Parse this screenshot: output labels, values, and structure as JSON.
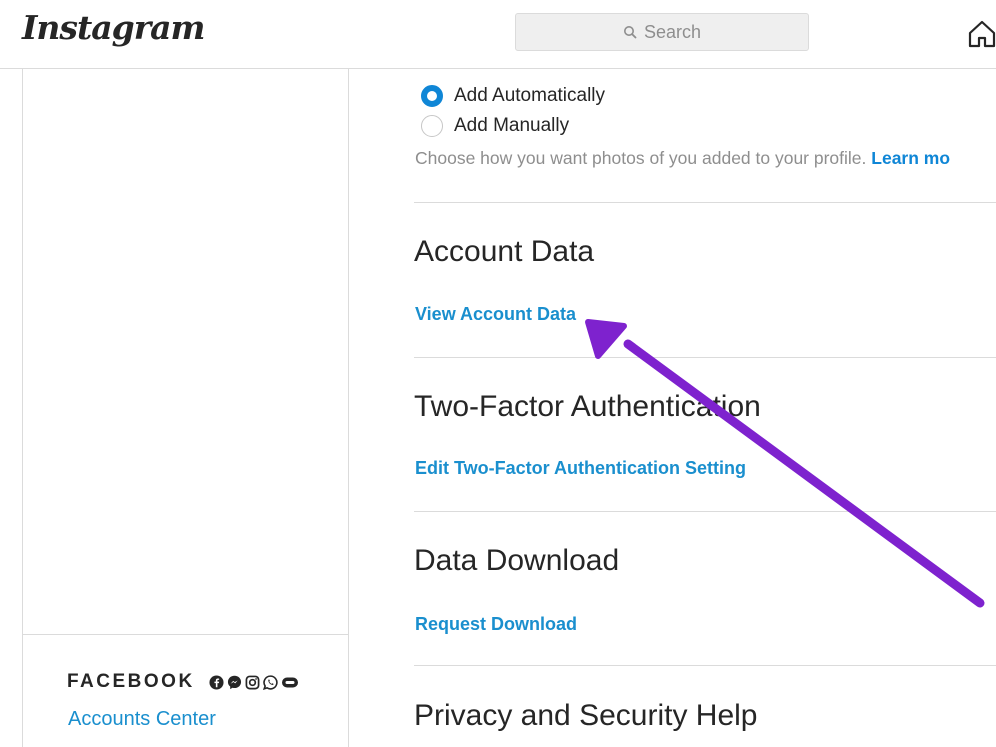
{
  "header": {
    "logo": "Instagram",
    "search_placeholder": "Search",
    "home_icon": "home-icon"
  },
  "photos_of_you": {
    "options": [
      {
        "label": "Add Automatically",
        "selected": true
      },
      {
        "label": "Add Manually",
        "selected": false
      }
    ],
    "helper_text": "Choose how you want photos of you added to your profile.",
    "learn_more": "Learn mo"
  },
  "sections": [
    {
      "title": "Account Data",
      "link": "View Account Data"
    },
    {
      "title": "Two-Factor Authentication",
      "link": "Edit Two-Factor Authentication Setting"
    },
    {
      "title": "Data Download",
      "link": "Request Download"
    },
    {
      "title": "Privacy and Security Help"
    }
  ],
  "sidebar": {
    "facebook_label": "FACEBOOK",
    "facebook_icons": [
      "facebook-icon",
      "messenger-icon",
      "instagram-icon",
      "whatsapp-icon",
      "portal-icon"
    ],
    "accounts_center": "Accounts Center"
  },
  "colors": {
    "link_blue": "#1a8fce",
    "radio_blue": "#0f86d6",
    "annotation_arrow": "#7e22ce",
    "divider": "#dbdbdb"
  }
}
